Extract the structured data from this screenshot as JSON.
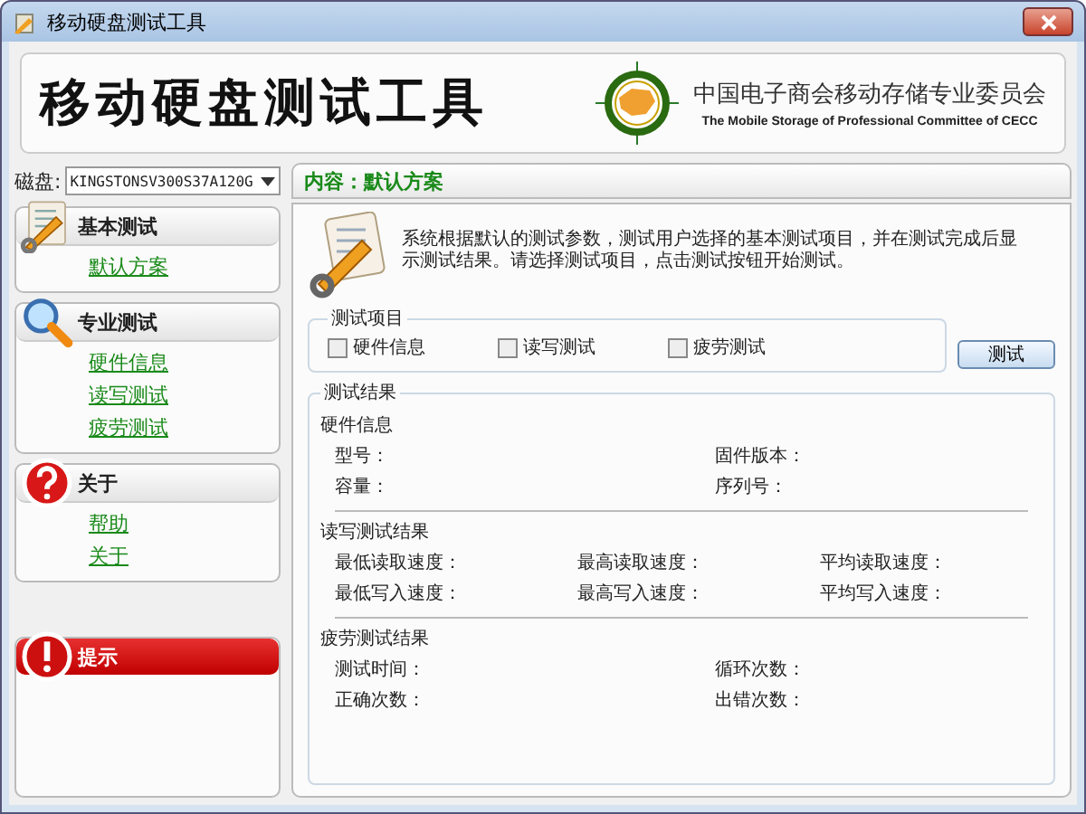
{
  "window": {
    "title": "移动硬盘测试工具"
  },
  "banner": {
    "title": "移动硬盘测试工具",
    "org_name": "中国电子商会移动存储专业委员会",
    "org_subtitle": "The Mobile Storage of Professional Committee of CECC"
  },
  "disk": {
    "label": "磁盘:",
    "value": "KINGSTONSV300S37A120G"
  },
  "sidebar": {
    "sections": [
      {
        "kind": "basic",
        "title": "基本测试",
        "items": [
          {
            "label": "默认方案"
          }
        ]
      },
      {
        "kind": "pro",
        "title": "专业测试",
        "items": [
          {
            "label": "硬件信息"
          },
          {
            "label": "读写测试"
          },
          {
            "label": "疲劳测试"
          }
        ]
      },
      {
        "kind": "about",
        "title": "关于",
        "items": [
          {
            "label": "帮助"
          },
          {
            "label": "关于"
          }
        ]
      },
      {
        "kind": "tip",
        "title": "提示"
      }
    ]
  },
  "content": {
    "header": "内容：默认方案",
    "description": "系统根据默认的测试参数，测试用户选择的基本测试项目，并在测试完成后显示测试结果。请选择测试项目，点击测试按钮开始测试。",
    "test_items": {
      "title": "测试项目",
      "options": [
        {
          "label": "硬件信息",
          "checked": false
        },
        {
          "label": "读写测试",
          "checked": false
        },
        {
          "label": "疲劳测试",
          "checked": false
        }
      ]
    },
    "test_button": "测试",
    "results": {
      "title": "测试结果",
      "groups": [
        {
          "title": "硬件信息",
          "rows": [
            [
              "型号：",
              "固件版本："
            ],
            [
              "容量：",
              "序列号："
            ]
          ]
        },
        {
          "title": "读写测试结果",
          "rows": [
            [
              "最低读取速度：",
              "最高读取速度：",
              "平均读取速度："
            ],
            [
              "最低写入速度：",
              "最高写入速度：",
              "平均写入速度："
            ]
          ]
        },
        {
          "title": "疲劳测试结果",
          "rows": [
            [
              "测试时间：",
              "循环次数："
            ],
            [
              "正确次数：",
              "出错次数："
            ]
          ]
        }
      ]
    }
  }
}
